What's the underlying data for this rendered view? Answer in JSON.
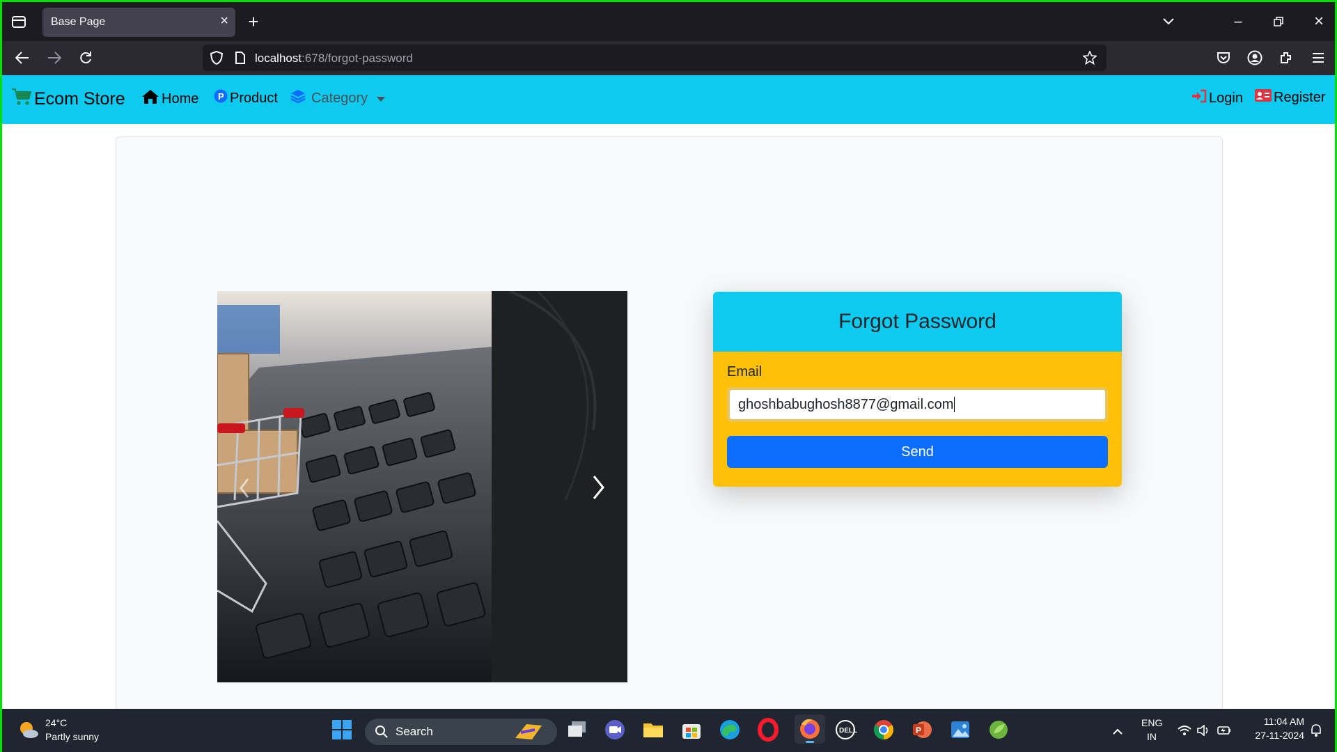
{
  "browser": {
    "tab_title": "Base Page",
    "url_host": "localhost",
    "url_path": ":678/forgot-password"
  },
  "navbar": {
    "brand": "Ecom Store",
    "home": "Home",
    "product": "Product",
    "category": "Category",
    "login": "Login",
    "register": "Register"
  },
  "form": {
    "title": "Forgot Password",
    "email_label": "Email",
    "email_value": "ghoshbabughosh8877@gmail.com",
    "send_button": "Send"
  },
  "taskbar": {
    "temperature": "24°C",
    "weather": "Partly sunny",
    "search_placeholder": "Search",
    "lang_top": "ENG",
    "lang_bottom": "IN",
    "time": "11:04 AM",
    "date": "27-11-2024"
  },
  "colors": {
    "navbar": "#0dcaf0",
    "card_body": "#ffc107",
    "button": "#0d6efd",
    "frame_border": "#00e000"
  }
}
